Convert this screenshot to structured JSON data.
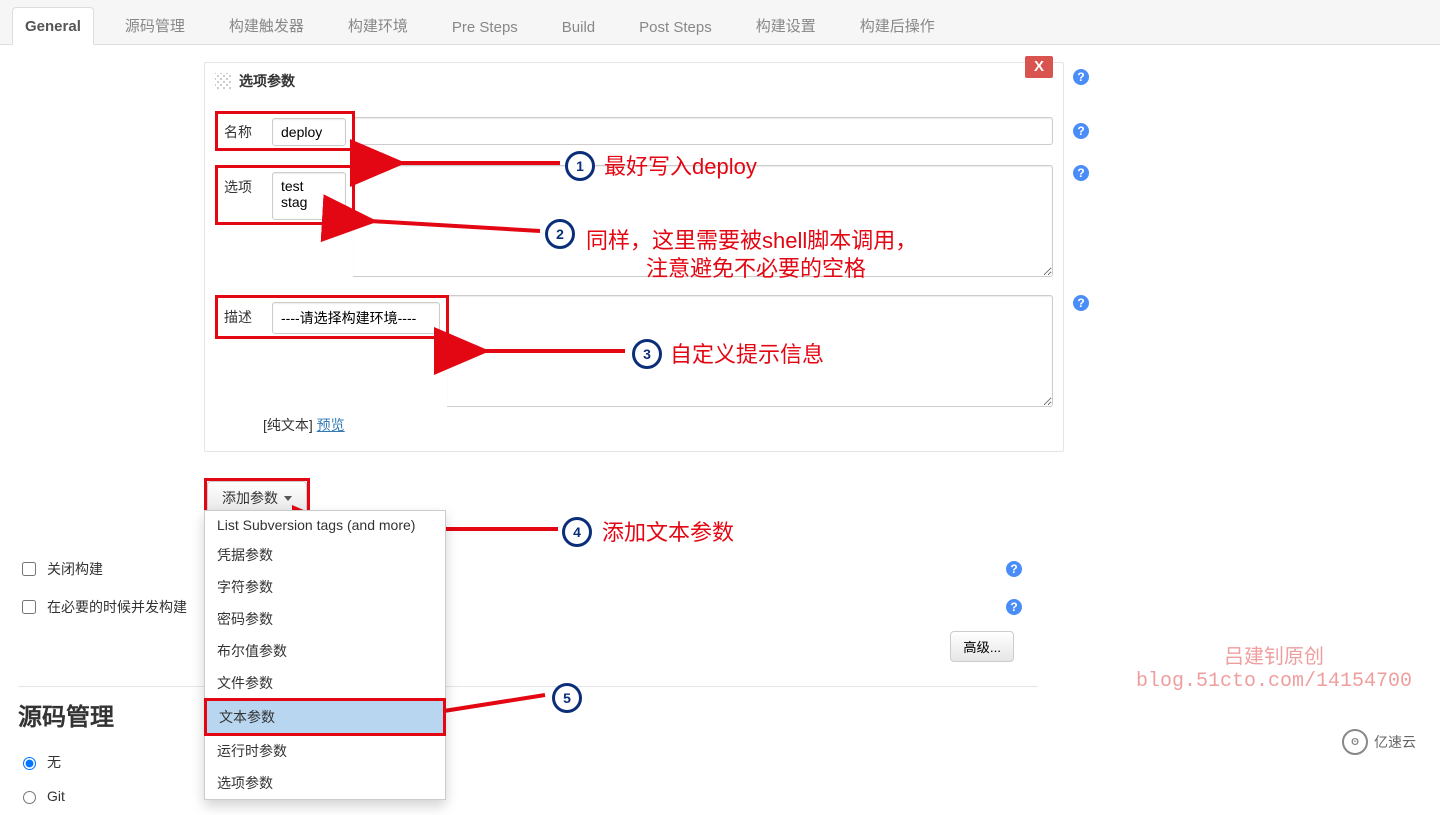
{
  "tabs": {
    "general": "General",
    "scm": "源码管理",
    "triggers": "构建触发器",
    "env": "构建环境",
    "pre": "Pre Steps",
    "build": "Build",
    "post": "Post Steps",
    "settings": "构建设置",
    "postactions": "构建后操作"
  },
  "section": {
    "title": "选项参数",
    "delete": "X",
    "name_label": "名称",
    "name_value": "deploy",
    "options_label": "选项",
    "options_value": "test\nstag",
    "desc_label": "描述",
    "desc_value": "----请选择构建环境----",
    "plain_text": "[纯文本]",
    "preview": "预览"
  },
  "add_param_label": "添加参数",
  "dropdown": {
    "items": [
      "List Subversion tags (and more)",
      "凭据参数",
      "字符参数",
      "密码参数",
      "布尔值参数",
      "文件参数",
      "文本参数",
      "运行时参数",
      "选项参数"
    ],
    "selected_index": 6
  },
  "checkbox": {
    "close_build": "关闭构建",
    "concurrent": "在必要的时候并发构建"
  },
  "advanced": "高级...",
  "scm_heading": "源码管理",
  "radio": {
    "none": "无",
    "git": "Git"
  },
  "annotations": {
    "a1": "最好写入deploy",
    "a2a": "同样，这里需要被shell脚本调用，",
    "a2b": "注意避免不必要的空格",
    "a3": "自定义提示信息",
    "a4": "添加文本参数"
  },
  "watermark": {
    "line1": "吕建钊原创",
    "line2": "blog.51cto.com/14154700"
  },
  "brand": "亿速云"
}
